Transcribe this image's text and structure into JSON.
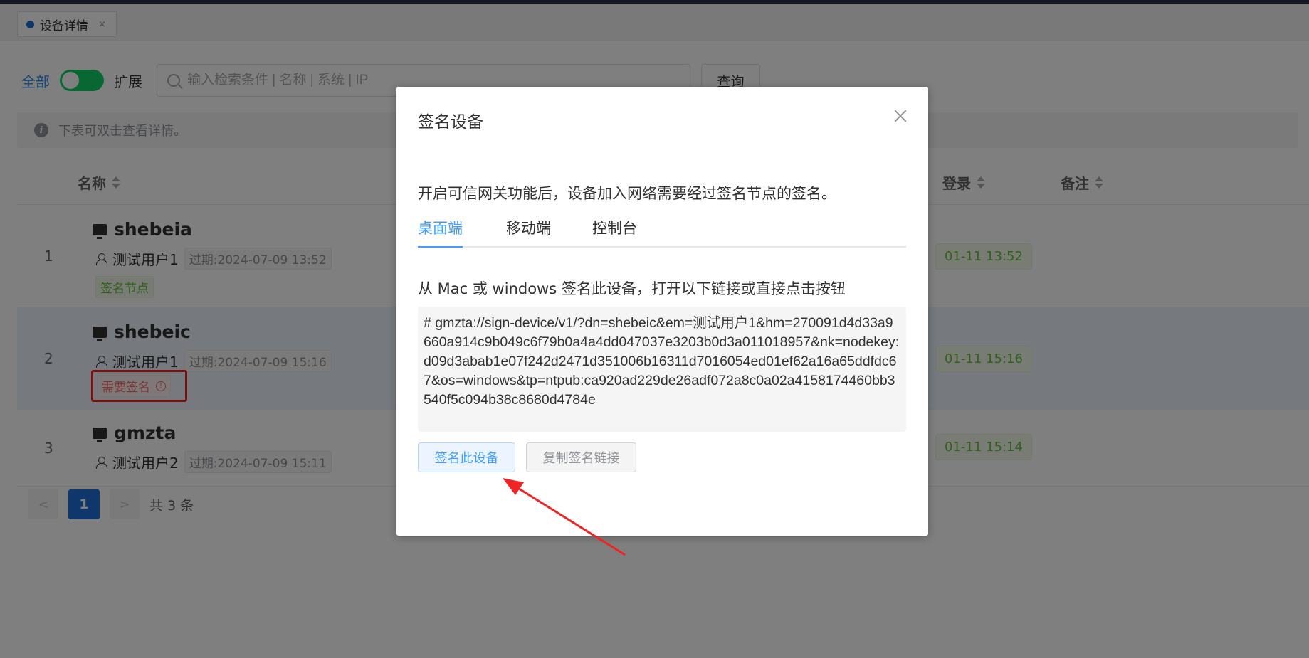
{
  "tabs": [
    {
      "label": "设备详情",
      "close": "×"
    }
  ],
  "toolbar": {
    "all_label": "全部",
    "expand_label": "扩展",
    "search_placeholder": "输入检索条件 | 名称 | 系统 | IP",
    "query_label": "查询"
  },
  "alert": {
    "text": "下表可双击查看详情。"
  },
  "table": {
    "headers": {
      "name": "名称",
      "login": "登录",
      "note": "备注"
    },
    "rows": [
      {
        "index": "1",
        "name": "shebeia",
        "user": "测试用户1",
        "expires": "过期:2024-07-09 13:52",
        "tag": "签名节点",
        "login": "01-11 13:52"
      },
      {
        "index": "2",
        "name": "shebeic",
        "user": "测试用户1",
        "expires": "过期:2024-07-09 15:16",
        "tag": "需要签名",
        "login": "01-11 15:16"
      },
      {
        "index": "3",
        "name": "gmzta",
        "user": "测试用户2",
        "expires": "过期:2024-07-09 15:11",
        "tag": "",
        "login": "01-11 15:14"
      }
    ]
  },
  "pagination": {
    "prev": "<",
    "current": "1",
    "next": ">",
    "total": "共 3 条"
  },
  "modal": {
    "title": "签名设备",
    "description": "开启可信网关功能后，设备加入网络需要经过签名节点的签名。",
    "tabs": [
      "桌面端",
      "移动端",
      "控制台"
    ],
    "subtitle": "从 Mac 或 windows 签名此设备，打开以下链接或直接点击按钮",
    "link": "# gmzta://sign-device/v1/?dn=shebeic&em=测试用户1&hm=270091d4d33a9660a914c9b049c6f79b0a4a4dd047037e3203b0d3a011018957&nk=nodekey:d09d3abab1e07f242d2471d351006b16311d7016054ed01ef62a16a65ddfdc67&os=windows&tp=ntpub:ca920ad229de26adf072a8c0a02a4158174460bb3540f5c094b38c8680d4784e",
    "sign_button": "签名此设备",
    "copy_button": "复制签名链接"
  },
  "colors": {
    "accent": "#409eff",
    "success": "#67c23a",
    "danger": "#f56c6c",
    "annotation": "#f02424"
  }
}
